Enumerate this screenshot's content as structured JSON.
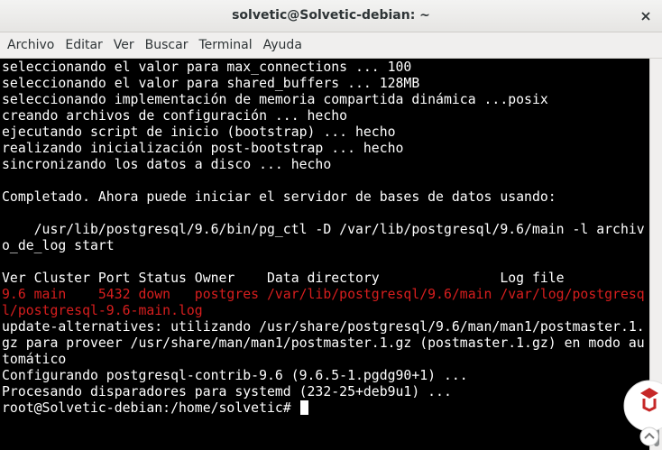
{
  "window": {
    "title": "solvetic@Solvetic-debian: ~"
  },
  "menu": {
    "items": [
      "Archivo",
      "Editar",
      "Ver",
      "Buscar",
      "Terminal",
      "Ayuda"
    ]
  },
  "terminal": {
    "lines": [
      "seleccionando el valor para max_connections ... 100",
      "seleccionando el valor para shared_buffers ... 128MB",
      "seleccionando implementación de memoria compartida dinámica ...posix",
      "creando archivos de configuración ... hecho",
      "ejecutando script de inicio (bootstrap) ... hecho",
      "realizando inicialización post-bootstrap ... hecho",
      "sincronizando los datos a disco ... hecho",
      "",
      "Completado. Ahora puede iniciar el servidor de bases de datos usando:",
      "",
      "    /usr/lib/postgresql/9.6/bin/pg_ctl -D /var/lib/postgresql/9.6/main -l archiv",
      "o_de_log start",
      "",
      "Ver Cluster Port Status Owner    Data directory               Log file",
      "9.6 main    5432 down   postgres /var/lib/postgresql/9.6/main /var/log/postgresq",
      "l/postgresql-9.6-main.log",
      "update-alternatives: utilizando /usr/share/postgresql/9.6/man/man1/postmaster.1.",
      "gz para proveer /usr/share/man/man1/postmaster.1.gz (postmaster.1.gz) en modo au",
      "tomático",
      "Configurando postgresql-contrib-9.6 (9.6.5-1.pgdg90+1) ...",
      "Procesando disparadores para systemd (232-25+deb9u1) ...",
      "root@Solvetic-debian:/home/solvetic# "
    ],
    "highlight_color": "#d81e1e",
    "text_color": "#ffffff",
    "background": "#000000"
  },
  "icons": {
    "close": "close-icon",
    "watermark": "solvetic-logo-icon"
  }
}
